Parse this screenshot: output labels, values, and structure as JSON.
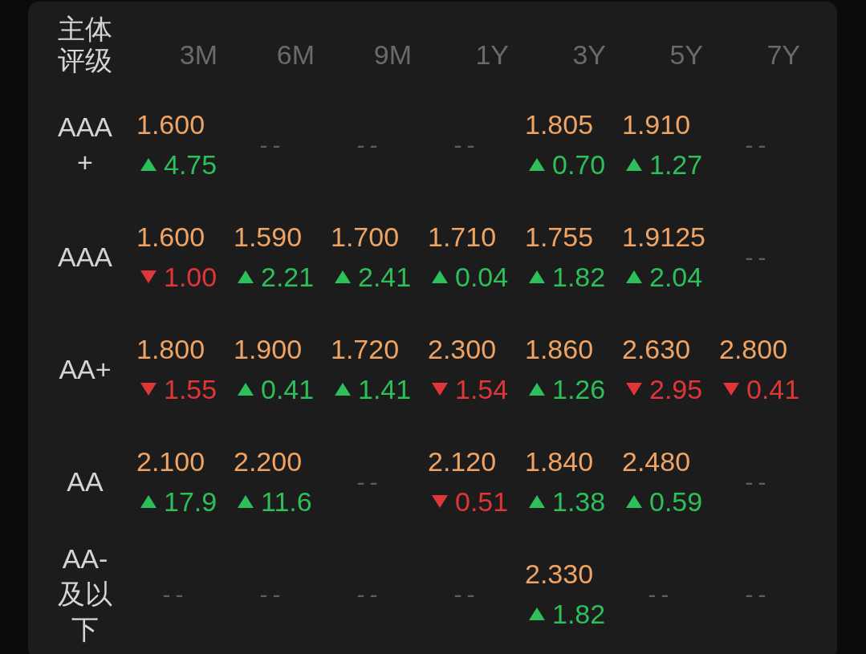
{
  "table": {
    "corner_label": "主体评级",
    "columns": [
      "3M",
      "6M",
      "9M",
      "1Y",
      "3Y",
      "5Y",
      "7Y"
    ],
    "rows": [
      {
        "rating": "AAA+",
        "cells": [
          {
            "kind": "up",
            "value": "1.600",
            "change": "4.75"
          },
          {
            "kind": "empty",
            "text": "--"
          },
          {
            "kind": "empty",
            "text": "--"
          },
          {
            "kind": "empty",
            "text": "--"
          },
          {
            "kind": "up",
            "value": "1.805",
            "change": "0.70"
          },
          {
            "kind": "up",
            "value": "1.910",
            "change": "1.27"
          },
          {
            "kind": "empty",
            "text": "--"
          }
        ]
      },
      {
        "rating": "AAA",
        "cells": [
          {
            "kind": "down",
            "value": "1.600",
            "change": "1.00"
          },
          {
            "kind": "up",
            "value": "1.590",
            "change": "2.21"
          },
          {
            "kind": "up",
            "value": "1.700",
            "change": "2.41"
          },
          {
            "kind": "up",
            "value": "1.710",
            "change": "0.04"
          },
          {
            "kind": "up",
            "value": "1.755",
            "change": "1.82"
          },
          {
            "kind": "up",
            "value": "1.9125",
            "change": "2.04"
          },
          {
            "kind": "empty",
            "text": "--"
          }
        ]
      },
      {
        "rating": "AA+",
        "cells": [
          {
            "kind": "down",
            "value": "1.800",
            "change": "1.55"
          },
          {
            "kind": "up",
            "value": "1.900",
            "change": "0.41"
          },
          {
            "kind": "up",
            "value": "1.720",
            "change": "1.41"
          },
          {
            "kind": "down",
            "value": "2.300",
            "change": "1.54"
          },
          {
            "kind": "up",
            "value": "1.860",
            "change": "1.26"
          },
          {
            "kind": "down",
            "value": "2.630",
            "change": "2.95"
          },
          {
            "kind": "down",
            "value": "2.800",
            "change": "0.41"
          }
        ]
      },
      {
        "rating": "AA",
        "cells": [
          {
            "kind": "up",
            "value": "2.100",
            "change": "17.9"
          },
          {
            "kind": "up",
            "value": "2.200",
            "change": "11.6"
          },
          {
            "kind": "empty",
            "text": "--"
          },
          {
            "kind": "down",
            "value": "2.120",
            "change": "0.51"
          },
          {
            "kind": "up",
            "value": "1.840",
            "change": "1.38"
          },
          {
            "kind": "up",
            "value": "2.480",
            "change": "0.59"
          },
          {
            "kind": "empty",
            "text": "--"
          }
        ]
      },
      {
        "rating": "AA-及以下",
        "cells": [
          {
            "kind": "empty",
            "text": "--"
          },
          {
            "kind": "empty",
            "text": "--"
          },
          {
            "kind": "empty",
            "text": "--"
          },
          {
            "kind": "empty",
            "text": "--"
          },
          {
            "kind": "up",
            "value": "2.330",
            "change": "1.82"
          },
          {
            "kind": "empty",
            "text": "--"
          },
          {
            "kind": "empty",
            "text": "--"
          }
        ]
      }
    ]
  }
}
